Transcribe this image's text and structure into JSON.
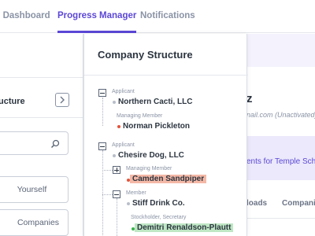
{
  "nav": {
    "tabs": [
      {
        "label": "s Dashboard"
      },
      {
        "label": "Progress Manager"
      },
      {
        "label": "Notifications"
      }
    ],
    "active_color": "#5b47d6"
  },
  "sidebar": {
    "title": "ucture",
    "buttons": [
      "Yourself",
      "Companies"
    ]
  },
  "background": {
    "title_fragment": "z",
    "email_fragment": "nail.com (Unactivated)",
    "banner_text": "ents for Temple Sch",
    "tabs": [
      "loads",
      "Compani"
    ]
  },
  "panel": {
    "title": "Company Structure",
    "nodes": [
      {
        "role": "Applicant",
        "name": "Northern Cacti, LLC",
        "status_color": "#b8bec9"
      },
      {
        "role": "Managing Member",
        "name": "Norman Pickleton",
        "status_color": "#e5533c"
      },
      {
        "role": "Applicant",
        "name": "Chesire Dog, LLC",
        "status_color": "#b8bec9"
      },
      {
        "role": "Managing Member",
        "name": "Camden Sandpiper",
        "status_color": "#e5533c",
        "highlight": "#f4b8a6"
      },
      {
        "role": "Member",
        "name": "Stiff Drink Co.",
        "status_color": "#b8bec9"
      },
      {
        "role": "Stockholder, Secretary",
        "name": "Demitri Renaldson-Plautt",
        "status_color": "#39b54a",
        "highlight": "#bfe7c4"
      }
    ]
  }
}
